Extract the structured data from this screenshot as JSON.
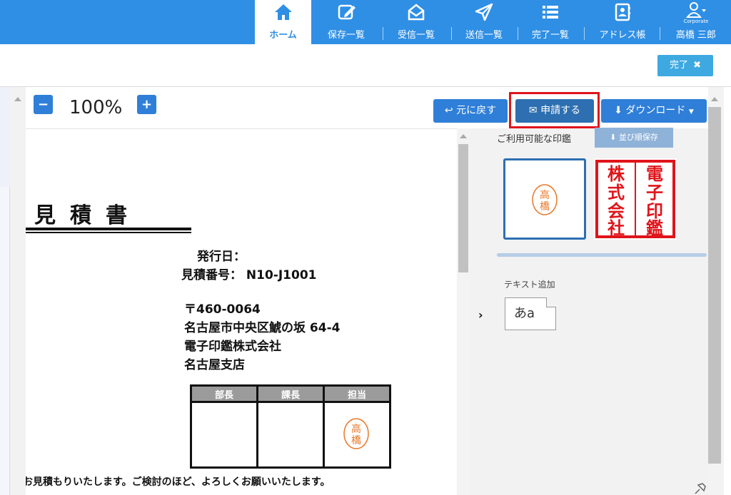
{
  "nav": {
    "items": [
      {
        "label": "ホーム",
        "icon": "home-icon",
        "active": true
      },
      {
        "label": "保存一覧",
        "icon": "edit-icon"
      },
      {
        "label": "受信一覧",
        "icon": "inbox-icon"
      },
      {
        "label": "送信一覧",
        "icon": "send-icon"
      },
      {
        "label": "完了一覧",
        "icon": "list-icon"
      },
      {
        "label": "アドレス帳",
        "icon": "address-book-icon"
      }
    ],
    "user": {
      "corp": "Corporate",
      "name": "高橋 三郎",
      "icon": "user-icon"
    }
  },
  "subbar": {
    "done_label": "完了"
  },
  "viewer": {
    "zoom": "100%",
    "minus": "−",
    "plus": "+"
  },
  "actions": {
    "back": "元に戻す",
    "apply": "申請する",
    "download": "ダウンロード"
  },
  "document": {
    "title": "見積書",
    "issue_date_label": "発行日：",
    "estimate_no": "見積番号： N10-J1001",
    "postal": "〒460-0064",
    "address": "名古屋市中央区鯱の坂 64-4",
    "company": "電子印鑑株式会社",
    "branch": "名古屋支店",
    "stamp_headers": [
      "部長",
      "課長",
      "担当"
    ],
    "stamp_chars": [
      "高",
      "橋"
    ],
    "footer": "お見積もりいたします。ご検討のほど、よろしくお願いいたします。"
  },
  "panel": {
    "seals_label": "ご利用可能な印鑑",
    "sort_save": "並び順保存",
    "personal_seal": [
      "高",
      "橋"
    ],
    "company_seal": [
      "電",
      "子",
      "印",
      "鑑",
      "株",
      "式",
      "会",
      "社"
    ],
    "text_add_label": "テキスト追加",
    "text_sample": "あa"
  },
  "colors": {
    "nav": "#2f8fe5",
    "action": "#2f7fd8",
    "seal_red": "#e0141b",
    "seal_orange": "#e8782a"
  }
}
